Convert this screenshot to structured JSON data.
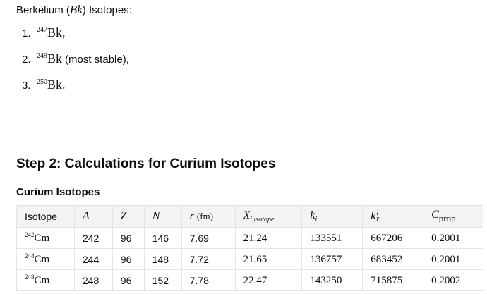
{
  "intro": {
    "prefix": "Berkelium (",
    "symbol": "Bk",
    "suffix": ") Isotopes:"
  },
  "isotope_list": [
    {
      "number": "1.",
      "mass": "247",
      "element": "Bk",
      "note": "",
      "end": ","
    },
    {
      "number": "2.",
      "mass": "249",
      "element": "Bk",
      "note": "(most stable),",
      "end": ""
    },
    {
      "number": "3.",
      "mass": "250",
      "element": "Bk",
      "note": "",
      "end": "."
    }
  ],
  "step_heading": "Step 2: Calculations for Curium Isotopes",
  "table_title": "Curium Isotopes",
  "table": {
    "headers": {
      "isotope": "Isotope",
      "A": "A",
      "Z": "Z",
      "N": "N",
      "r_sym": "r",
      "r_unit": "(fm)",
      "X_sym": "X",
      "X_sub": "i,isotope",
      "k_sym": "k",
      "k_sub": "i",
      "kr_sym": "k",
      "kr_sub": "r",
      "kr_sup": "i",
      "C_sym": "C",
      "C_sub": "prop"
    },
    "rows": [
      {
        "mass": "242",
        "element": "Cm",
        "A": "242",
        "Z": "96",
        "N": "146",
        "r": "7.69",
        "X": "21.24",
        "k": "133551",
        "kr": "667206",
        "C": "0.2001"
      },
      {
        "mass": "244",
        "element": "Cm",
        "A": "244",
        "Z": "96",
        "N": "148",
        "r": "7.72",
        "X": "21.65",
        "k": "136757",
        "kr": "683452",
        "C": "0.2001"
      },
      {
        "mass": "248",
        "element": "Cm",
        "A": "248",
        "Z": "96",
        "N": "152",
        "r": "7.78",
        "X": "22.47",
        "k": "143250",
        "kr": "715875",
        "C": "0.2002"
      }
    ]
  }
}
